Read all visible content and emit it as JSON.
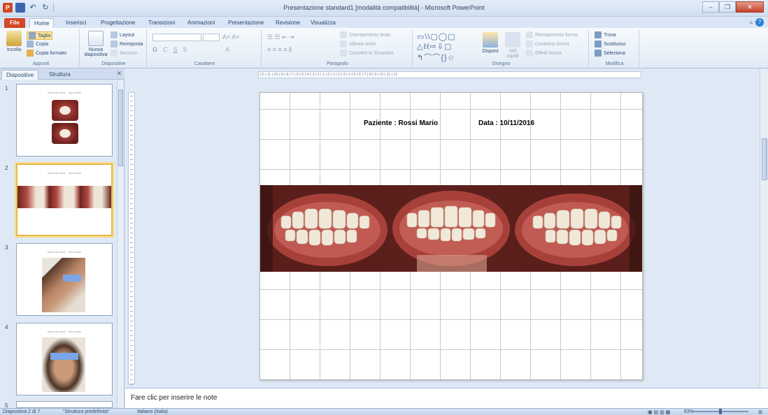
{
  "window": {
    "title": "Presentazione standard1 [modalità compatibilità] - Microsoft PowerPoint"
  },
  "ribbon": {
    "tabs": [
      {
        "label": "File"
      },
      {
        "label": "Home"
      },
      {
        "label": "Inserisci"
      },
      {
        "label": "Progettazione"
      },
      {
        "label": "Transizioni"
      },
      {
        "label": "Animazioni"
      },
      {
        "label": "Presentazione"
      },
      {
        "label": "Revisione"
      },
      {
        "label": "Visualizza"
      }
    ],
    "groups": {
      "appunti": {
        "label": "Appunti",
        "paste": "Incolla",
        "cut": "Taglia",
        "copy": "Copia",
        "format_painter": "Copia formato"
      },
      "diapositive": {
        "label": "Diapositive",
        "new_slide": "Nuova diapositiva",
        "layout": "Layout",
        "reset": "Reimposta",
        "section": "Sezione"
      },
      "carattere": {
        "label": "Carattere"
      },
      "paragrafo": {
        "label": "Paragrafo",
        "text_direction": "Orientamento testo",
        "align_text": "Allinea testo",
        "smartart": "Converti in SmartArt"
      },
      "disegno": {
        "label": "Disegno",
        "arrange": "Disponi",
        "quick_styles": "Stili rapidi",
        "fill": "Riempimento forma",
        "outline": "Contorno forma",
        "effects": "Effetti forma"
      },
      "modifica": {
        "label": "Modifica",
        "find": "Trova",
        "replace": "Sostituisci",
        "select": "Seleziona"
      }
    }
  },
  "left_panel": {
    "tab_slides": "Diapositive",
    "tab_outline": "Struttura",
    "thumbnails": [
      {
        "number": "1"
      },
      {
        "number": "2"
      },
      {
        "number": "3"
      },
      {
        "number": "4"
      },
      {
        "number": "5"
      }
    ]
  },
  "slide": {
    "patient": "Paziente : Rossi Mario",
    "date": "Data : 10/11/2016"
  },
  "notes": {
    "placeholder": "Fare clic per inserire le note"
  },
  "status": {
    "slide_info": "Diapositiva 2 di 7",
    "theme": "\"Struttura predefinita\"",
    "language": "Italiano (Italia)",
    "zoom": "63%"
  },
  "colors": {
    "file_tab": "#d24726",
    "selected_thumb": "#e7b94a",
    "ribbon_bg": "#e2ebf6"
  }
}
